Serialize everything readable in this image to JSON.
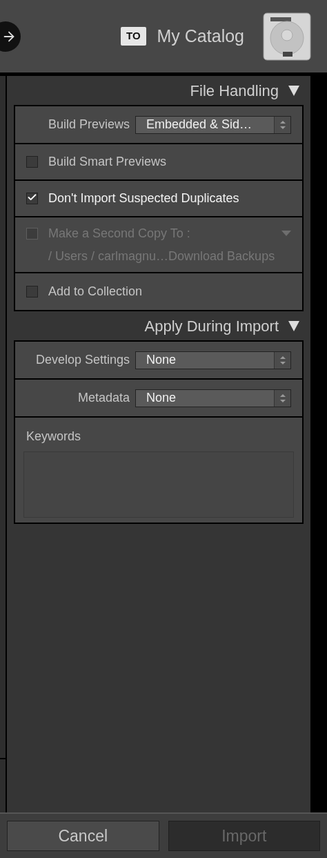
{
  "header": {
    "badge": "TO",
    "title": "My Catalog"
  },
  "sections": [
    {
      "title": "File Handling",
      "expanded": true,
      "rows": [
        {
          "kind": "select",
          "label": "Build Previews",
          "value": "Embedded & Sid…"
        },
        {
          "kind": "checkbox",
          "label": "Build Smart Previews",
          "checked": false,
          "disabled": false
        },
        {
          "kind": "checkbox",
          "label": "Don't Import Suspected Duplicates",
          "checked": true,
          "disabled": false
        },
        {
          "kind": "checkbox",
          "label": "Make a Second Copy To :",
          "checked": false,
          "disabled": true,
          "dropdown": true,
          "path": "/ Users / carlmagnu…Download Backups"
        },
        {
          "kind": "checkbox",
          "label": "Add to Collection",
          "checked": false,
          "disabled": false
        }
      ]
    },
    {
      "title": "Apply During Import",
      "expanded": true,
      "rows": [
        {
          "kind": "select",
          "label": "Develop Settings",
          "value": "None"
        },
        {
          "kind": "select",
          "label": "Metadata",
          "value": "None"
        },
        {
          "kind": "textarea",
          "label": "Keywords"
        }
      ]
    }
  ],
  "buttons": [
    {
      "label": "Cancel",
      "disabled": false
    },
    {
      "label": "Import",
      "disabled": true
    }
  ]
}
